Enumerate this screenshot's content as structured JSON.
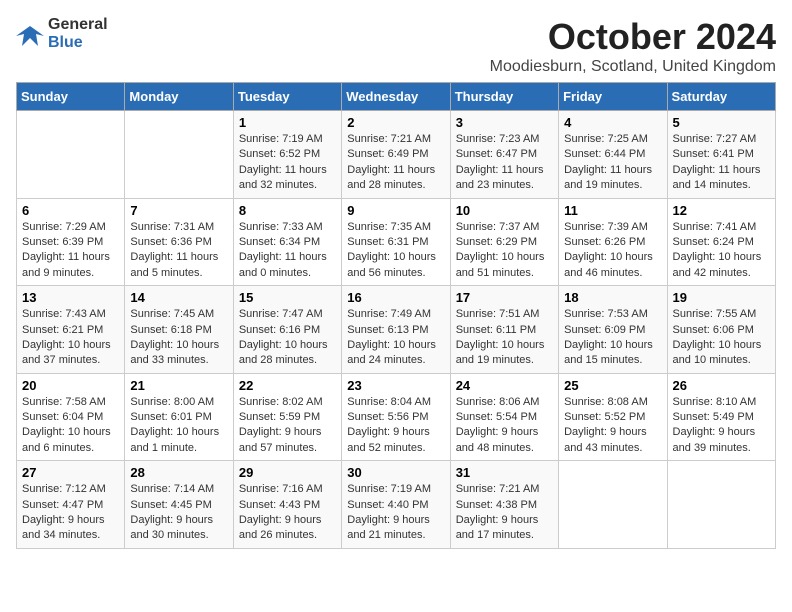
{
  "header": {
    "logo_general": "General",
    "logo_blue": "Blue",
    "title": "October 2024",
    "subtitle": "Moodiesburn, Scotland, United Kingdom"
  },
  "calendar": {
    "days_of_week": [
      "Sunday",
      "Monday",
      "Tuesday",
      "Wednesday",
      "Thursday",
      "Friday",
      "Saturday"
    ],
    "weeks": [
      [
        {
          "day": "",
          "info": ""
        },
        {
          "day": "",
          "info": ""
        },
        {
          "day": "1",
          "info": "Sunrise: 7:19 AM\nSunset: 6:52 PM\nDaylight: 11 hours and 32 minutes."
        },
        {
          "day": "2",
          "info": "Sunrise: 7:21 AM\nSunset: 6:49 PM\nDaylight: 11 hours and 28 minutes."
        },
        {
          "day": "3",
          "info": "Sunrise: 7:23 AM\nSunset: 6:47 PM\nDaylight: 11 hours and 23 minutes."
        },
        {
          "day": "4",
          "info": "Sunrise: 7:25 AM\nSunset: 6:44 PM\nDaylight: 11 hours and 19 minutes."
        },
        {
          "day": "5",
          "info": "Sunrise: 7:27 AM\nSunset: 6:41 PM\nDaylight: 11 hours and 14 minutes."
        }
      ],
      [
        {
          "day": "6",
          "info": "Sunrise: 7:29 AM\nSunset: 6:39 PM\nDaylight: 11 hours and 9 minutes."
        },
        {
          "day": "7",
          "info": "Sunrise: 7:31 AM\nSunset: 6:36 PM\nDaylight: 11 hours and 5 minutes."
        },
        {
          "day": "8",
          "info": "Sunrise: 7:33 AM\nSunset: 6:34 PM\nDaylight: 11 hours and 0 minutes."
        },
        {
          "day": "9",
          "info": "Sunrise: 7:35 AM\nSunset: 6:31 PM\nDaylight: 10 hours and 56 minutes."
        },
        {
          "day": "10",
          "info": "Sunrise: 7:37 AM\nSunset: 6:29 PM\nDaylight: 10 hours and 51 minutes."
        },
        {
          "day": "11",
          "info": "Sunrise: 7:39 AM\nSunset: 6:26 PM\nDaylight: 10 hours and 46 minutes."
        },
        {
          "day": "12",
          "info": "Sunrise: 7:41 AM\nSunset: 6:24 PM\nDaylight: 10 hours and 42 minutes."
        }
      ],
      [
        {
          "day": "13",
          "info": "Sunrise: 7:43 AM\nSunset: 6:21 PM\nDaylight: 10 hours and 37 minutes."
        },
        {
          "day": "14",
          "info": "Sunrise: 7:45 AM\nSunset: 6:18 PM\nDaylight: 10 hours and 33 minutes."
        },
        {
          "day": "15",
          "info": "Sunrise: 7:47 AM\nSunset: 6:16 PM\nDaylight: 10 hours and 28 minutes."
        },
        {
          "day": "16",
          "info": "Sunrise: 7:49 AM\nSunset: 6:13 PM\nDaylight: 10 hours and 24 minutes."
        },
        {
          "day": "17",
          "info": "Sunrise: 7:51 AM\nSunset: 6:11 PM\nDaylight: 10 hours and 19 minutes."
        },
        {
          "day": "18",
          "info": "Sunrise: 7:53 AM\nSunset: 6:09 PM\nDaylight: 10 hours and 15 minutes."
        },
        {
          "day": "19",
          "info": "Sunrise: 7:55 AM\nSunset: 6:06 PM\nDaylight: 10 hours and 10 minutes."
        }
      ],
      [
        {
          "day": "20",
          "info": "Sunrise: 7:58 AM\nSunset: 6:04 PM\nDaylight: 10 hours and 6 minutes."
        },
        {
          "day": "21",
          "info": "Sunrise: 8:00 AM\nSunset: 6:01 PM\nDaylight: 10 hours and 1 minute."
        },
        {
          "day": "22",
          "info": "Sunrise: 8:02 AM\nSunset: 5:59 PM\nDaylight: 9 hours and 57 minutes."
        },
        {
          "day": "23",
          "info": "Sunrise: 8:04 AM\nSunset: 5:56 PM\nDaylight: 9 hours and 52 minutes."
        },
        {
          "day": "24",
          "info": "Sunrise: 8:06 AM\nSunset: 5:54 PM\nDaylight: 9 hours and 48 minutes."
        },
        {
          "day": "25",
          "info": "Sunrise: 8:08 AM\nSunset: 5:52 PM\nDaylight: 9 hours and 43 minutes."
        },
        {
          "day": "26",
          "info": "Sunrise: 8:10 AM\nSunset: 5:49 PM\nDaylight: 9 hours and 39 minutes."
        }
      ],
      [
        {
          "day": "27",
          "info": "Sunrise: 7:12 AM\nSunset: 4:47 PM\nDaylight: 9 hours and 34 minutes."
        },
        {
          "day": "28",
          "info": "Sunrise: 7:14 AM\nSunset: 4:45 PM\nDaylight: 9 hours and 30 minutes."
        },
        {
          "day": "29",
          "info": "Sunrise: 7:16 AM\nSunset: 4:43 PM\nDaylight: 9 hours and 26 minutes."
        },
        {
          "day": "30",
          "info": "Sunrise: 7:19 AM\nSunset: 4:40 PM\nDaylight: 9 hours and 21 minutes."
        },
        {
          "day": "31",
          "info": "Sunrise: 7:21 AM\nSunset: 4:38 PM\nDaylight: 9 hours and 17 minutes."
        },
        {
          "day": "",
          "info": ""
        },
        {
          "day": "",
          "info": ""
        }
      ]
    ]
  }
}
